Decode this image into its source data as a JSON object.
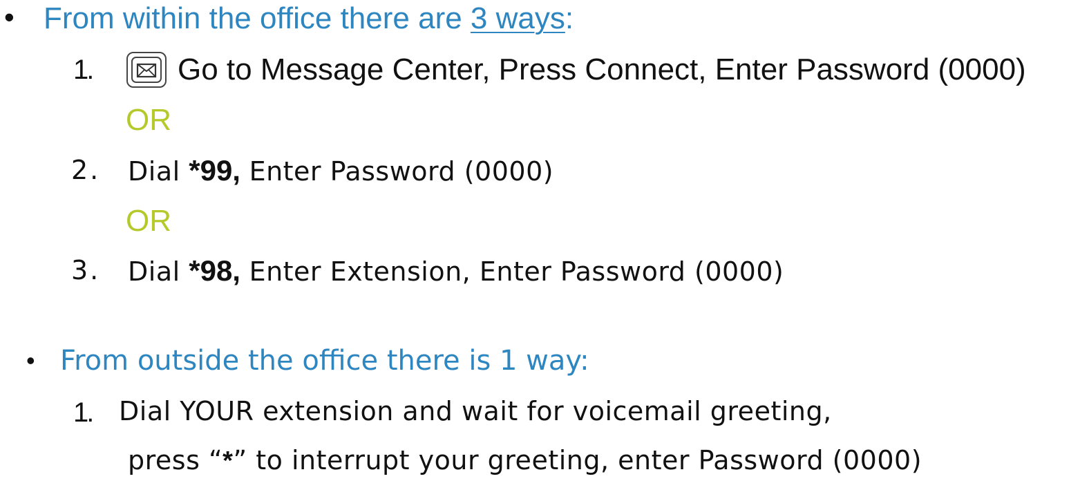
{
  "section_inside": {
    "bullet": "•",
    "heading_prefix": "From within the office there are ",
    "heading_link": "3 ways",
    "heading_suffix": ":",
    "step1": {
      "number": "1.",
      "icon": "message-envelope-icon",
      "text": "Go to Message Center, Press Connect, Enter Password (0000)"
    },
    "or_1": "OR",
    "step2": {
      "number": "2.",
      "prefix": "Dial ",
      "code": "*99,",
      "text": " Enter Password (0000)"
    },
    "or_2": "OR",
    "step3": {
      "number": "3.",
      "prefix": "Dial ",
      "code": "*98,",
      "text": " Enter Extension, Enter Password (0000)"
    }
  },
  "section_outside": {
    "bullet": "•",
    "heading": "From outside the office there is 1 way:",
    "step1": {
      "number": "1.",
      "line1": "Dial YOUR extension and wait for voicemail greeting,",
      "line2_prefix": "press “",
      "line2_star": "*",
      "line2_suffix": "” to interrupt your greeting, enter Password (0000)"
    }
  },
  "colors": {
    "heading_blue": "#2e86c1",
    "or_green": "#b5c92a",
    "body_text": "#111111"
  }
}
